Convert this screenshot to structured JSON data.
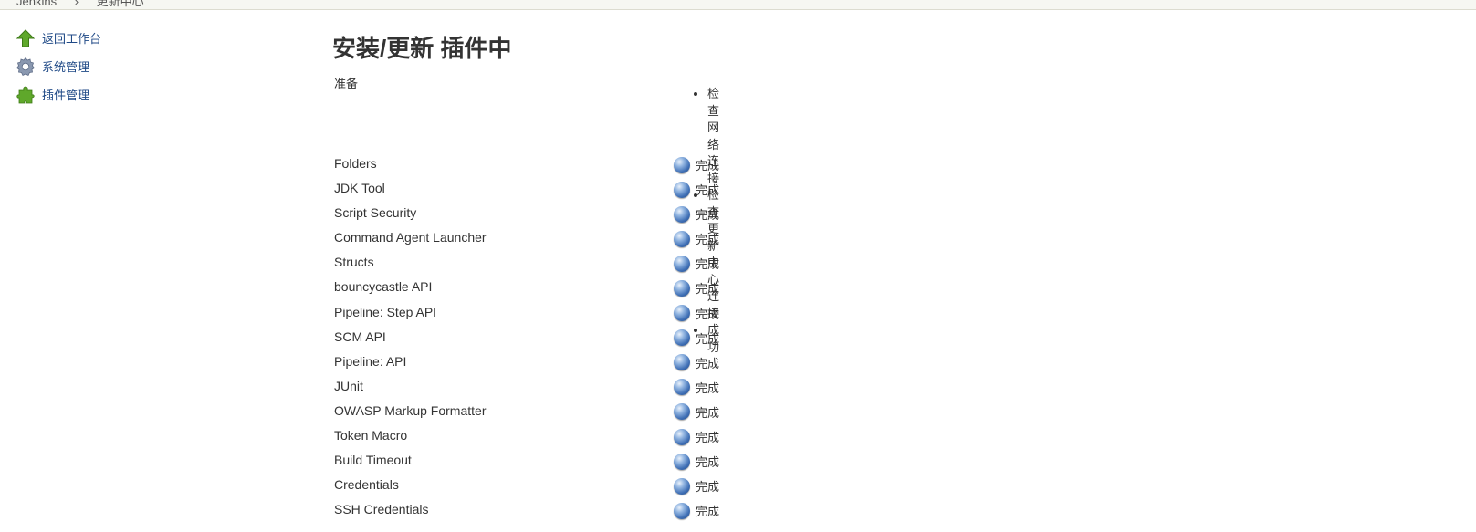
{
  "breadcrumb": [
    "Jenkins",
    "更新中心"
  ],
  "side_tasks": [
    {
      "label": "返回工作台",
      "icon": "up-arrow-icon"
    },
    {
      "label": "系统管理",
      "icon": "gear-icon"
    },
    {
      "label": "插件管理",
      "icon": "puzzle-icon"
    }
  ],
  "main": {
    "title": "安装/更新 插件中",
    "prep_label": "准备",
    "prep_steps": [
      "检查网络连接",
      "检查更新中心连接",
      "成功"
    ]
  },
  "plugins": [
    {
      "name": "Folders",
      "status": "完成"
    },
    {
      "name": "JDK Tool",
      "status": "完成"
    },
    {
      "name": "Script Security",
      "status": "完成"
    },
    {
      "name": "Command Agent Launcher",
      "status": "完成"
    },
    {
      "name": "Structs",
      "status": "完成"
    },
    {
      "name": "bouncycastle API",
      "status": "完成"
    },
    {
      "name": "Pipeline: Step API",
      "status": "完成"
    },
    {
      "name": "SCM API",
      "status": "完成"
    },
    {
      "name": "Pipeline: API",
      "status": "完成"
    },
    {
      "name": "JUnit",
      "status": "完成"
    },
    {
      "name": "OWASP Markup Formatter",
      "status": "完成"
    },
    {
      "name": "Token Macro",
      "status": "完成"
    },
    {
      "name": "Build Timeout",
      "status": "完成"
    },
    {
      "name": "Credentials",
      "status": "完成"
    },
    {
      "name": "SSH Credentials",
      "status": "完成"
    }
  ],
  "colors": {
    "link": "#204a87",
    "text": "#333333",
    "status_ball": "#3f6fb5",
    "header_bg": "#f6f7f2"
  }
}
